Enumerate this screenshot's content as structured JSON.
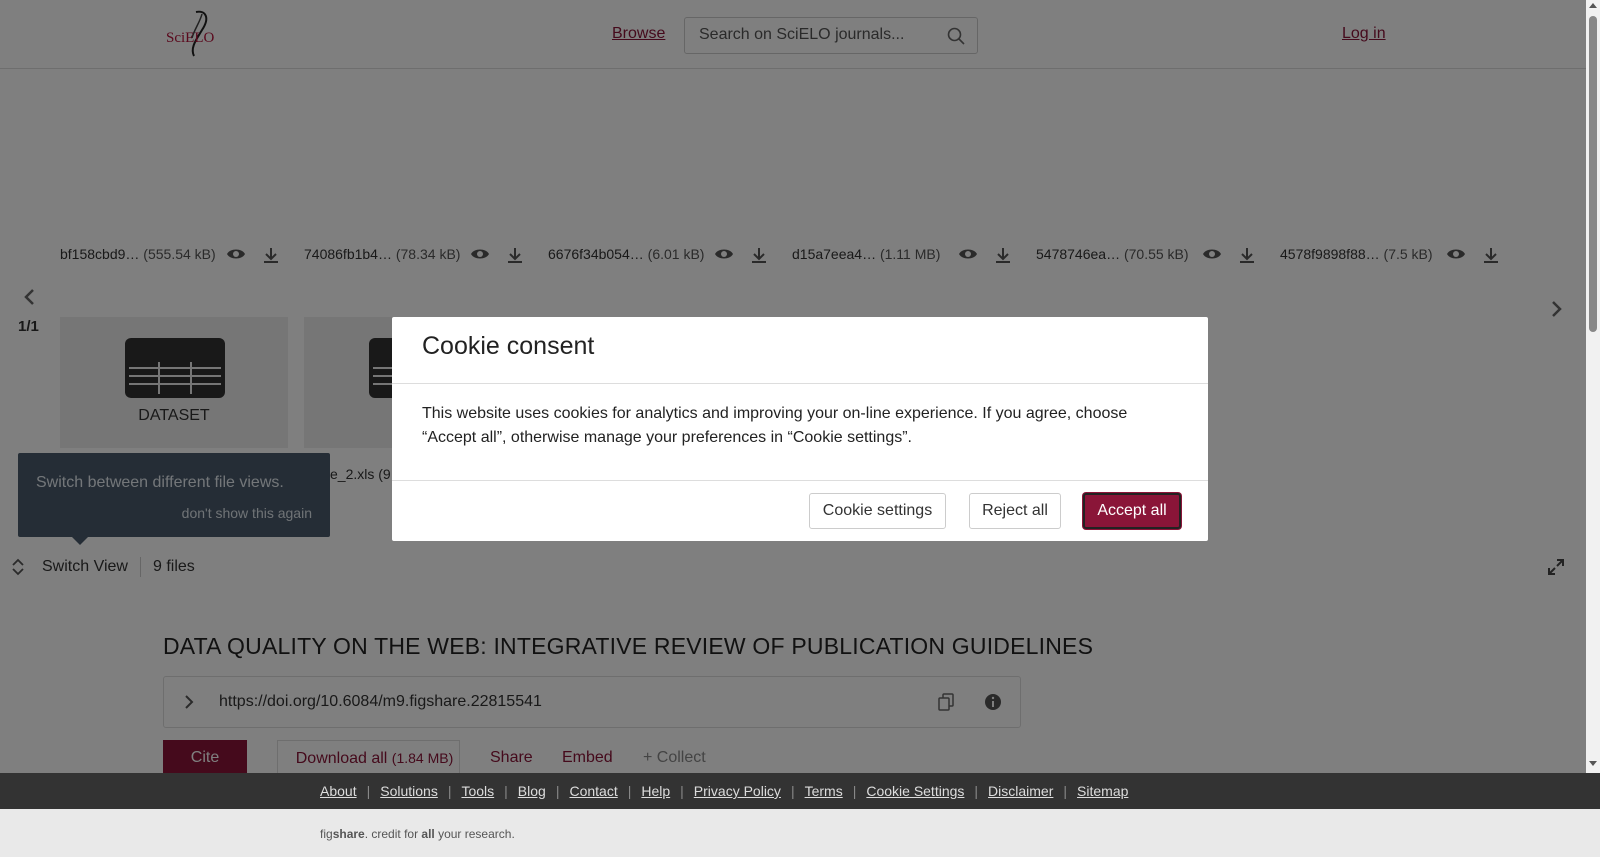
{
  "header": {
    "logo_text": "SciELO",
    "browse_label": "Browse",
    "search_placeholder": "Search on SciELO journals...",
    "login_label": "Log in"
  },
  "viewer": {
    "files": [
      {
        "name": "bf158cbd9…",
        "size": "(555.54 kB)"
      },
      {
        "name": "74086fb1b4…",
        "size": "(78.34 kB)"
      },
      {
        "name": "6676f34b054…",
        "size": "(6.01 kB)"
      },
      {
        "name": "d15a7eea4…",
        "size": "(1.11 MB)"
      },
      {
        "name": "5478746ea…",
        "size": "(70.55 kB)"
      },
      {
        "name": "4578f9898f88…",
        "size": "(7.5 kB)"
      }
    ],
    "page_indicator": "1/1",
    "cards": [
      {
        "caption": "DATASET"
      },
      {
        "caption": "D"
      }
    ],
    "second_filename": "e_2.xls (9",
    "tooltip_text": "Switch between different file views.",
    "tooltip_dismiss": "don't show this again",
    "switch_view_label": "Switch View",
    "file_count": "9 files"
  },
  "article": {
    "title": "DATA QUALITY ON THE WEB: INTEGRATIVE REVIEW OF PUBLICATION GUIDELINES",
    "doi": "https://doi.org/10.6084/m9.figshare.22815541",
    "cite_label": "Cite",
    "download_label": "Download all",
    "download_size": "(1.84 MB)",
    "share_label": "Share",
    "embed_label": "Embed",
    "collect_label": "+ Collect"
  },
  "cookie_modal": {
    "title": "Cookie consent",
    "body": "This website uses cookies for analytics and improving your on-line experience. If you agree, choose “Accept all”, otherwise manage your preferences in “Cookie settings”.",
    "settings_label": "Cookie settings",
    "reject_label": "Reject all",
    "accept_label": "Accept all"
  },
  "footer": {
    "links": [
      "About",
      "Solutions",
      "Tools",
      "Blog",
      "Contact",
      "Help",
      "Privacy Policy",
      "Terms",
      "Cookie Settings",
      "Disclaimer",
      "Sitemap"
    ],
    "tagline_brand_a": "fig",
    "tagline_brand_b": "share",
    "tagline_mid": ". credit for ",
    "tagline_all": "all",
    "tagline_end": " your research."
  },
  "colors": {
    "brand": "#8a1538",
    "footer_dark": "#333333",
    "tooltip": "#4a5b6c"
  }
}
